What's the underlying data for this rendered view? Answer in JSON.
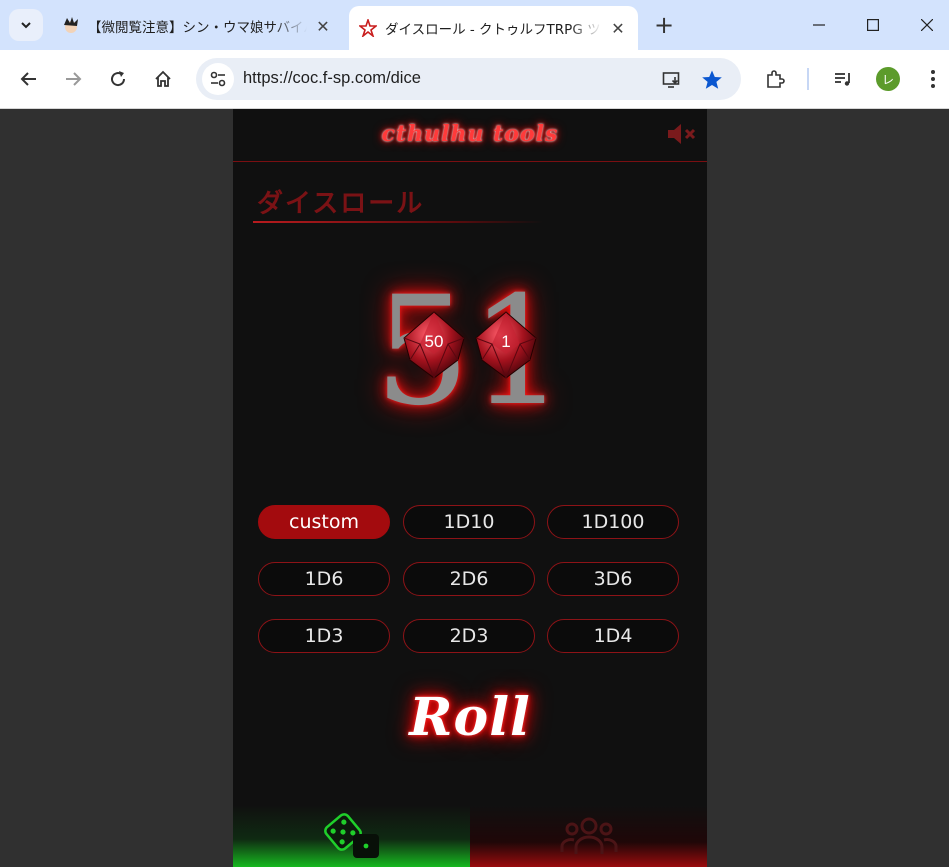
{
  "browser": {
    "tabs": [
      {
        "title": "【微閲覧注意】シン・ウマ娘サバイバル",
        "active": false
      },
      {
        "title": "ダイスロール - クトゥルフTRPG ツール",
        "active": true
      }
    ],
    "url": "https://coc.f-sp.com/dice",
    "profile_initial": "レ"
  },
  "app": {
    "logo": "cthulhu tools",
    "section_title": "ダイスロール",
    "result": "51",
    "dice": [
      {
        "value": "50",
        "icon": "d10-red-die-icon"
      },
      {
        "value": "1",
        "icon": "d10-red-die-icon"
      }
    ],
    "buttons": [
      {
        "label": "custom",
        "selected": true
      },
      {
        "label": "1D10",
        "selected": false
      },
      {
        "label": "1D100",
        "selected": false
      },
      {
        "label": "1D6",
        "selected": false
      },
      {
        "label": "2D6",
        "selected": false
      },
      {
        "label": "3D6",
        "selected": false
      },
      {
        "label": "1D3",
        "selected": false
      },
      {
        "label": "2D3",
        "selected": false
      },
      {
        "label": "1D4",
        "selected": false
      }
    ],
    "roll_label": "Roll",
    "bottom_nav": [
      {
        "icon": "dice-icon",
        "active": true,
        "color": "#17b81f"
      },
      {
        "icon": "group-icon",
        "active": false,
        "color": "#9a0b0d"
      }
    ]
  }
}
